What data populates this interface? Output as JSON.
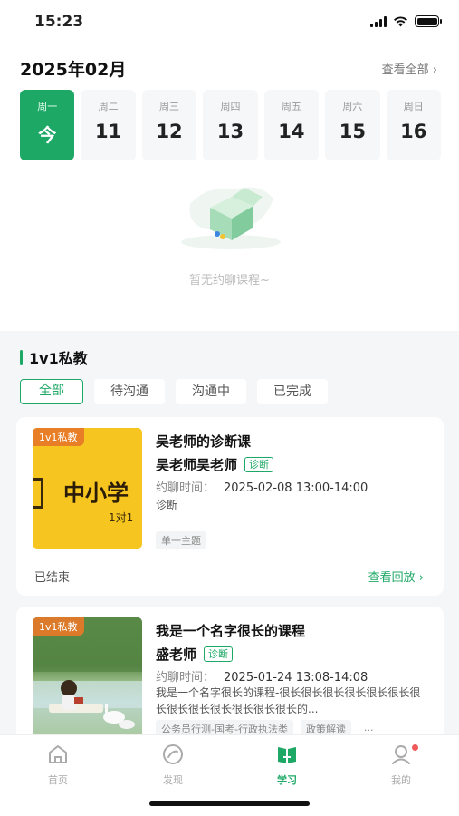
{
  "status_bar": {
    "time": "15:23"
  },
  "calendar": {
    "month_title": "2025年02月",
    "view_all": "查看全部 ›",
    "days": [
      {
        "weekday": "周一",
        "day": "今",
        "active": true
      },
      {
        "weekday": "周二",
        "day": "11"
      },
      {
        "weekday": "周三",
        "day": "12"
      },
      {
        "weekday": "周四",
        "day": "13"
      },
      {
        "weekday": "周五",
        "day": "14"
      },
      {
        "weekday": "周六",
        "day": "15"
      },
      {
        "weekday": "周日",
        "day": "16"
      }
    ],
    "empty_text": "暂无约聊课程~"
  },
  "section": {
    "title": "1v1私教",
    "filters": [
      "全部",
      "待沟通",
      "沟通中",
      "已完成"
    ]
  },
  "courses": [
    {
      "badge": "1v1私教",
      "thumb_big": "中小学",
      "thumb_small": "1对1",
      "title": "吴老师的诊断课",
      "teacher": "吴老师吴老师",
      "tag": "诊断",
      "time_label": "约聊时间：",
      "time_value": "2025-02-08 13:00-14:00",
      "description": "诊断",
      "labels": [
        "单一主题"
      ],
      "status": "已结束",
      "action": "查看回放 ›"
    },
    {
      "badge": "1v1私教",
      "title": "我是一个名字很长的课程",
      "teacher": "盛老师",
      "tag": "诊断",
      "time_label": "约聊时间：",
      "time_value": "2025-01-24 13:08-14:08",
      "description": "我是一个名字很长的课程-很长很长很长很长很长很长很长很长很长很长很长很长很长的...",
      "labels": [
        "公务员行测-国考-行政执法类",
        "政策解读",
        "..."
      ]
    }
  ],
  "tabbar": {
    "tabs": [
      {
        "label": "首页",
        "icon": "home-icon"
      },
      {
        "label": "发现",
        "icon": "discover-icon"
      },
      {
        "label": "学习",
        "icon": "study-icon",
        "active": true
      },
      {
        "label": "我的",
        "icon": "profile-icon"
      }
    ]
  },
  "colors": {
    "accent": "#1ea866",
    "badge": "#e67828",
    "notification": "#f05a5a"
  }
}
